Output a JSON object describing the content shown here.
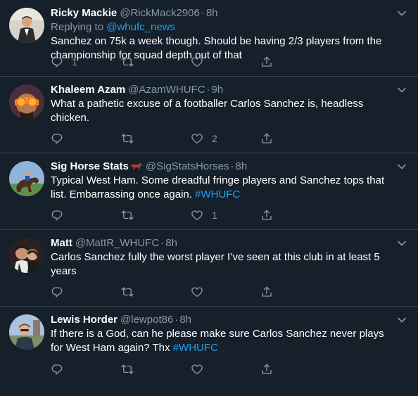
{
  "tweets": [
    {
      "name": "Ricky Mackie",
      "handle": "@RickMack2906",
      "time": "8h",
      "reply_prefix": "Replying to ",
      "reply_to": "@whufc_news",
      "text": "Sanchez on 75k a week though. Should be having 2/3 players from the championship for squad depth out of that",
      "hashtag": "",
      "reply_count": "1",
      "retweet_count": "",
      "like_count": ""
    },
    {
      "name": "Khaleem Azam",
      "handle": "@AzamWHUFC",
      "time": "9h",
      "reply_prefix": "",
      "reply_to": "",
      "text": "What a pathetic excuse of a footballer Carlos Sanchez is, headless chicken.",
      "hashtag": "",
      "reply_count": "",
      "retweet_count": "",
      "like_count": "2"
    },
    {
      "name": "Sig Horse Stats",
      "handle": "@SigStatsHorses",
      "time": "8h",
      "reply_prefix": "",
      "reply_to": "",
      "text": "Typical West Ham. Some dreadful fringe players and Sanchez tops that list. Embarrassing once again. ",
      "hashtag": "#WHUFC",
      "reply_count": "",
      "retweet_count": "",
      "like_count": "1"
    },
    {
      "name": "Matt",
      "handle": "@MattR_WHUFC",
      "time": "8h",
      "reply_prefix": "",
      "reply_to": "",
      "text": "Carlos Sanchez fully the worst player I’ve seen at this club in at least 5 years",
      "hashtag": "",
      "reply_count": "",
      "retweet_count": "",
      "like_count": ""
    },
    {
      "name": "Lewis Horder",
      "handle": "@lewpot86",
      "time": "8h",
      "reply_prefix": "",
      "reply_to": "",
      "text": "If there is a God, can he please make sure Carlos Sanchez never plays for West Ham again? Thx ",
      "hashtag": "#WHUFC",
      "reply_count": "",
      "retweet_count": "",
      "like_count": ""
    }
  ],
  "separator": "·",
  "colors": {
    "background": "#15202b",
    "divider": "#38444d",
    "muted": "#8899a6",
    "link": "#1da1f2",
    "text": "#ffffff"
  },
  "icons": [
    "reply-icon",
    "retweet-icon",
    "like-icon",
    "share-icon",
    "chevron-down-icon",
    "horse-emoji-icon"
  ]
}
